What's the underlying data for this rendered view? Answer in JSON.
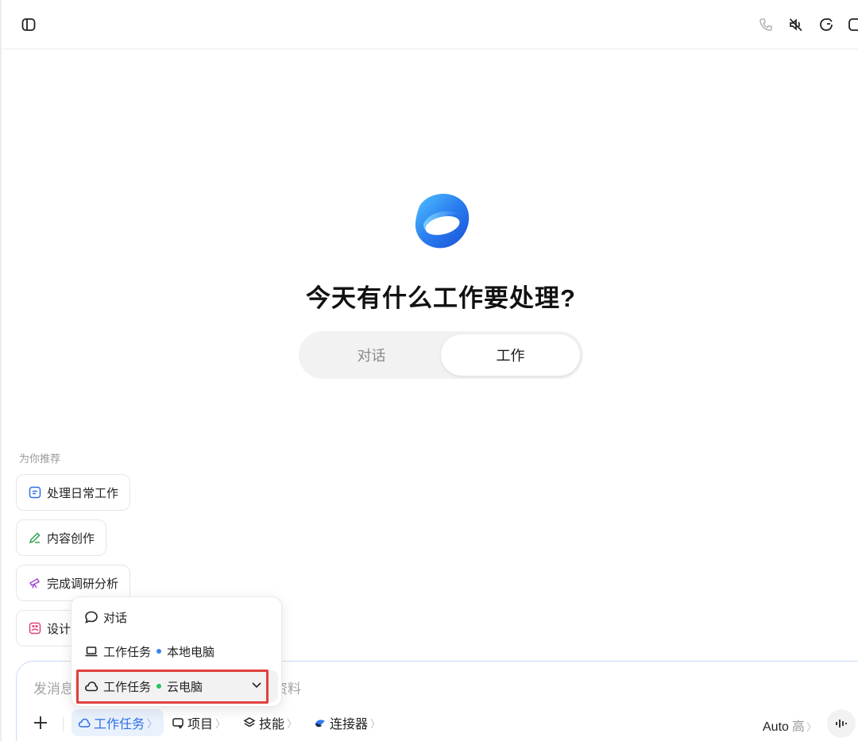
{
  "topbar": {
    "icons": [
      "sidebar-toggle-icon",
      "phone-icon",
      "mute-icon",
      "new-chat-icon",
      "panel-icon"
    ]
  },
  "hero": {
    "headline": "今天有什么工作要处理?",
    "modes": {
      "chat": "对话",
      "work": "工作",
      "selected": "工作"
    }
  },
  "recommendations": {
    "title": "为你推荐",
    "items": [
      {
        "label": "处理日常工作",
        "icon": "daily-work-icon",
        "color": "#2f6fe4"
      },
      {
        "label": "内容创作",
        "icon": "pen-icon",
        "color": "#2aa44f"
      },
      {
        "label": "完成调研分析",
        "icon": "telescope-icon",
        "color": "#a24ad6"
      },
      {
        "label": "设计",
        "icon": "image-icon",
        "color": "#e2447a"
      }
    ]
  },
  "composer": {
    "placeholder_left": "发消息",
    "placeholder_right": "资料",
    "tools": {
      "task": "工作任务",
      "project": "项目",
      "skills": "技能",
      "connectors": "连接器"
    },
    "model": "Auto",
    "level": "高"
  },
  "dropdown": {
    "items": [
      {
        "label": "对话",
        "icon": "chat-bubble-icon"
      },
      {
        "label": "工作任务",
        "tag": "本地电脑",
        "dot_color": "#3b82f6",
        "icon": "laptop-icon"
      },
      {
        "label": "工作任务",
        "tag": "云电脑",
        "dot_color": "#22c55e",
        "icon": "cloud-icon",
        "selected": true
      }
    ]
  }
}
